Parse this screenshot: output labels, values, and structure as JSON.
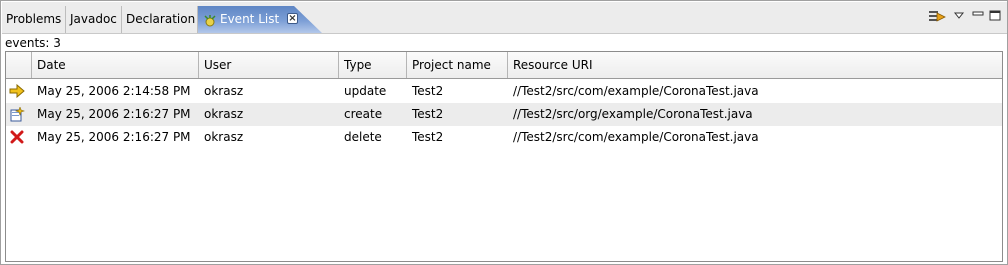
{
  "tabs": [
    {
      "label": "Problems"
    },
    {
      "label": "Javadoc"
    },
    {
      "label": "Declaration"
    },
    {
      "label": "Event List",
      "active": true
    }
  ],
  "toolbar": {
    "icons": [
      "filter-icon",
      "view-menu-icon",
      "minimize-icon",
      "maximize-icon"
    ]
  },
  "status": {
    "text": "events: 3"
  },
  "table": {
    "columns": [
      "",
      "Date",
      "User",
      "Type",
      "Project name",
      "Resource URI"
    ],
    "rows": [
      {
        "icon": "update-arrow-icon",
        "date": "May 25, 2006 2:14:58 PM",
        "user": "okrasz",
        "type": "update",
        "project": "Test2",
        "uri": "//Test2/src/com/example/CoronaTest.java"
      },
      {
        "icon": "create-file-icon",
        "date": "May 25, 2006 2:16:27 PM",
        "user": "okrasz",
        "type": "create",
        "project": "Test2",
        "uri": "//Test2/src/org/example/CoronaTest.java"
      },
      {
        "icon": "delete-x-icon",
        "date": "May 25, 2006 2:16:27 PM",
        "user": "okrasz",
        "type": "delete",
        "project": "Test2",
        "uri": "//Test2/src/com/example/CoronaTest.java"
      }
    ]
  },
  "colors": {
    "active_tab_start": "#5f86c4",
    "active_tab_end": "#b3c8ea",
    "alt_row": "#ececec",
    "delete_icon": "#d11919",
    "update_icon": "#f2c21b"
  }
}
